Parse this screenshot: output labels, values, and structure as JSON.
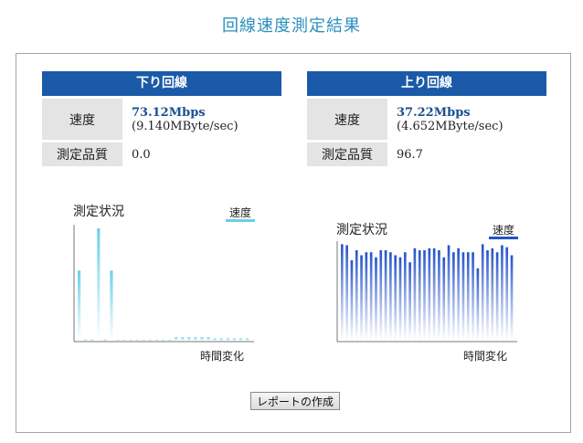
{
  "title": "回線速度測定結果",
  "download": {
    "header": "下り回線",
    "speed_label": "速度",
    "speed_mbps": "73.12Mbps",
    "speed_mbyte": "(9.140MByte/sec)",
    "quality_label": "測定品質",
    "quality_value": "0.0"
  },
  "upload": {
    "header": "上り回線",
    "speed_label": "速度",
    "speed_mbps": "37.22Mbps",
    "speed_mbyte": "(4.652MByte/sec)",
    "quality_label": "測定品質",
    "quality_value": "96.7"
  },
  "charts_text": {
    "down_title": "測定状況",
    "down_legend": "速度",
    "down_xlabel": "時間変化",
    "up_title": "測定状況",
    "up_legend": "速度",
    "up_xlabel": "時間変化"
  },
  "colors": {
    "title": "#2a8fbd",
    "header_bg": "#1a5aa8",
    "down_bar": "#6ccfe8",
    "up_bar": "#2452c8"
  },
  "chart_data": [
    {
      "type": "bar",
      "series": [
        {
          "name": "速度",
          "values": [
            0.6,
            0.01,
            0.01,
            0.96,
            0.01,
            0.6,
            0,
            0,
            0,
            0,
            0,
            0,
            0,
            0,
            0,
            0.03,
            0.03,
            0.03,
            0.03,
            0.03,
            0.03,
            0.02,
            0.02,
            0.02,
            0.02,
            0.02,
            0.02
          ]
        }
      ],
      "title": "測定状況",
      "xlabel": "時間変化",
      "ylim": [
        0,
        1
      ],
      "legend": "top-right",
      "grid": false
    },
    {
      "type": "bar",
      "series": [
        {
          "name": "速度",
          "values": [
            0.96,
            0.95,
            0.8,
            0.9,
            0.85,
            0.88,
            0.88,
            0.83,
            0.9,
            0.9,
            0.88,
            0.85,
            0.83,
            0.88,
            0.78,
            0.92,
            0.9,
            0.9,
            0.92,
            0.92,
            0.9,
            0.83,
            0.95,
            0.88,
            0.92,
            0.88,
            0.88,
            0.88,
            0.72,
            0.96,
            0.9,
            0.92,
            0.88,
            0.95,
            0.93,
            0.85
          ]
        }
      ],
      "title": "測定状況",
      "xlabel": "時間変化",
      "ylim": [
        0,
        1
      ],
      "legend": "top-right",
      "grid": false
    }
  ],
  "report_button": "レポートの作成"
}
